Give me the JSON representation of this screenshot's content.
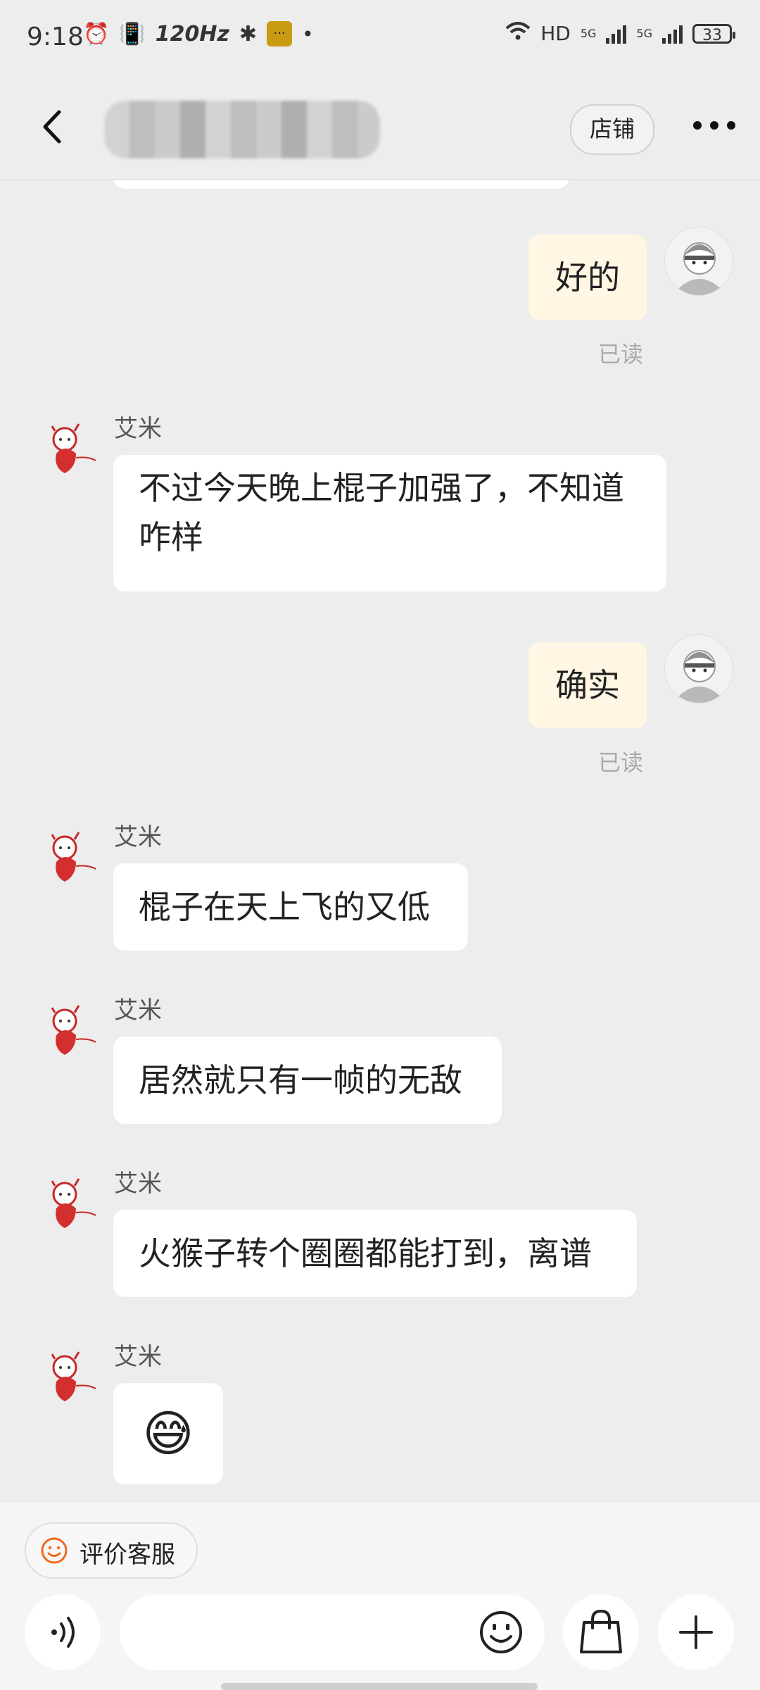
{
  "status_bar": {
    "time": "9:18",
    "refresh_rate": "120Hz",
    "network_label": "HD",
    "signal_1": "5G",
    "signal_2": "5G",
    "battery": "33"
  },
  "header": {
    "back_icon": "chevron-left-icon",
    "title_obscured": true,
    "shop_label": "店铺",
    "more_icon": "more-horizontal-icon"
  },
  "messages": [
    {
      "from": "me",
      "text": "好的",
      "read": "已读"
    },
    {
      "from": "other",
      "sender": "艾米",
      "text": "不过今天晚上棍子加强了，不知道咋样"
    },
    {
      "from": "me",
      "text": "确实",
      "read": "已读"
    },
    {
      "from": "other",
      "sender": "艾米",
      "text": "棍子在天上飞的又低"
    },
    {
      "from": "other",
      "sender": "艾米",
      "text": "居然就只有一帧的无敌"
    },
    {
      "from": "other",
      "sender": "艾米",
      "text": "火猴子转个圈圈都能打到，离谱"
    },
    {
      "from": "other",
      "sender": "艾米",
      "text": "😅"
    }
  ],
  "footer": {
    "rate_label": "评价客服",
    "voice_icon": "voice-icon",
    "emoji_icon": "emoji-icon",
    "bag_icon": "shopping-bag-icon",
    "plus_icon": "plus-icon"
  },
  "colors": {
    "background": "#ededed",
    "my_bubble": "#fff6e3",
    "other_bubble": "#ffffff",
    "accent_orange": "#f06a1e"
  }
}
